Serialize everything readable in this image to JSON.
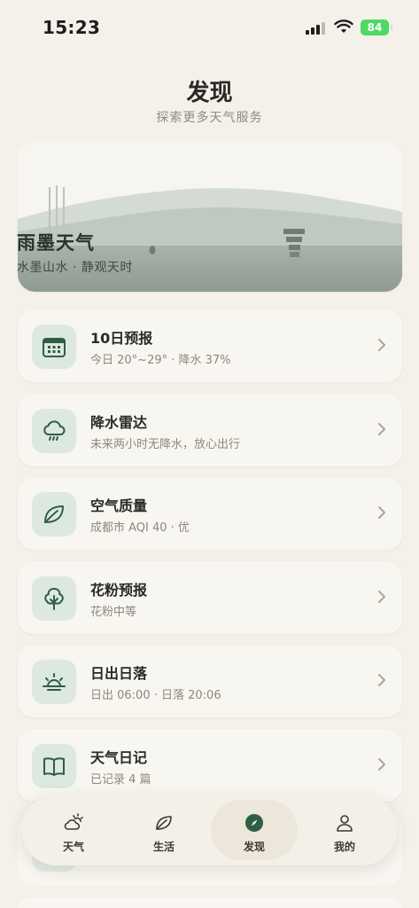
{
  "status_bar": {
    "time": "15:23",
    "battery": "84"
  },
  "header": {
    "title": "发现",
    "subtitle": "探索更多天气服务"
  },
  "hero": {
    "title": "雨墨天气",
    "subtitle": "水墨山水 · 静观天时"
  },
  "cards": [
    {
      "title": "10日预报",
      "subtitle": "今日 20°~29° · 降水 37%",
      "icon": "calendar-icon"
    },
    {
      "title": "降水雷达",
      "subtitle": "未来两小时无降水，放心出行",
      "icon": "rain-cloud-icon"
    },
    {
      "title": "空气质量",
      "subtitle": "成都市 AQI 40 · 优",
      "icon": "leaf-icon"
    },
    {
      "title": "花粉预报",
      "subtitle": "花粉中等",
      "icon": "tree-icon"
    },
    {
      "title": "日出日落",
      "subtitle": "日出 06:00 · 日落 20:06",
      "icon": "sunrise-icon"
    },
    {
      "title": "天气日记",
      "subtitle": "已记录 4 篇",
      "icon": "book-icon"
    }
  ],
  "tabbar": {
    "tabs": [
      {
        "label": "天气",
        "icon": "weather-icon"
      },
      {
        "label": "生活",
        "icon": "leaf-icon"
      },
      {
        "label": "发现",
        "icon": "compass-icon",
        "active": true
      },
      {
        "label": "我的",
        "icon": "person-icon"
      }
    ]
  },
  "colors": {
    "background": "#f4f1ea",
    "accent": "#2f5e47",
    "icon_tile": "#dde8df",
    "battery": "#4cd964"
  }
}
